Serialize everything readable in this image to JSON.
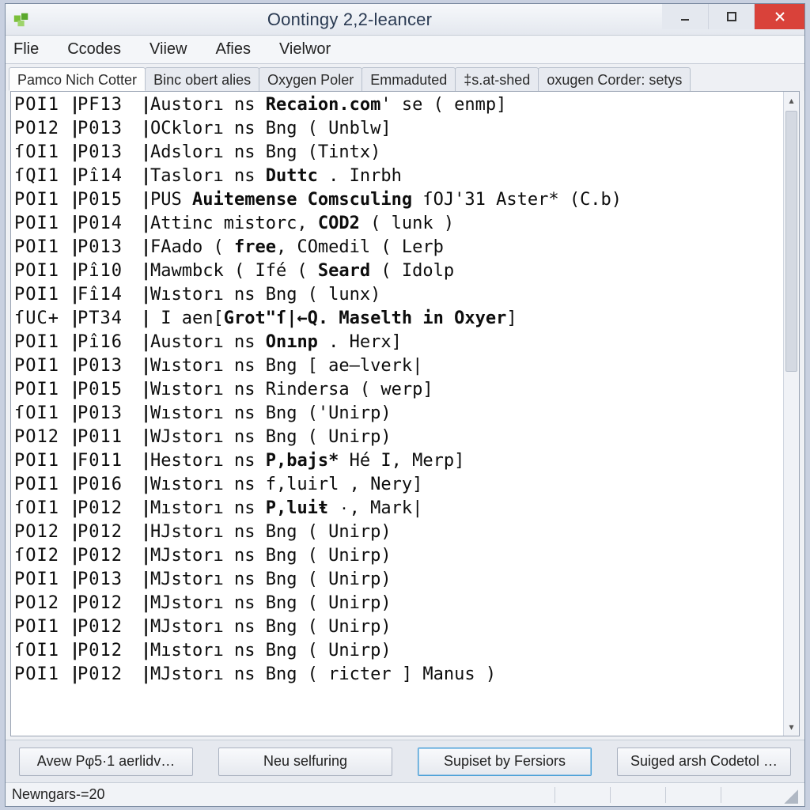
{
  "window": {
    "title": "Oontingy 2,2-leancer"
  },
  "menubar": {
    "items": [
      "Flie",
      "Ccodes",
      "Viiew",
      "Afies",
      "Vielwor"
    ]
  },
  "tabs": [
    {
      "label": "Pamco Nich Cotter",
      "active": true
    },
    {
      "label": "Binc obert alies",
      "active": false
    },
    {
      "label": "Oxygen Poler",
      "active": false
    },
    {
      "label": "Emmaduted",
      "active": false
    },
    {
      "label": "‡s.at-shed",
      "active": false
    },
    {
      "label": "oxugen Corder: setys",
      "active": false
    }
  ],
  "rows": [
    {
      "a": "POI1",
      "b": "PF13",
      "c_pre": "Austorı ns ",
      "c_bold": "Recaion.com",
      "c_post": "' se ( enmp]"
    },
    {
      "a": "PO12",
      "b": "P013",
      "c_pre": "OCklorı ns ",
      "c_bold": "",
      "c_post": "Bng ( Unblw]"
    },
    {
      "a": "ſOI1",
      "b": "P013",
      "c_pre": "Adslorı ns ",
      "c_bold": "",
      "c_post": "Bng (Tintx)"
    },
    {
      "a": "ſQI1",
      "b": "Pî14",
      "c_pre": "Taslorı ns ",
      "c_bold": "Duttc",
      "c_post": " . Inrbh"
    },
    {
      "a": "POI1",
      "b": "P015",
      "c_pre": "PUS ",
      "c_bold": "Auitemense Comsculing",
      "c_post": " ſOJ'31 Aster* (C.b)"
    },
    {
      "a": "POI1",
      "b": "P014",
      "c_pre": "Attinc mistorc, ",
      "c_bold": "COD2",
      "c_post": " ( lunk )"
    },
    {
      "a": "POI1",
      "b": "P013",
      "c_pre": "FAado ( ",
      "c_bold": "free",
      "c_post": ", COmedil ( Lerþ"
    },
    {
      "a": "POI1",
      "b": "Pî10",
      "c_pre": "Mawmbck ( Ifé ( ",
      "c_bold": "Seard",
      "c_post": " ( Idolp"
    },
    {
      "a": "POI1",
      "b": "Fî14",
      "c_pre": "W",
      "c_bold": "",
      "c_post": "ıstorı ns Bng ( lunx)"
    },
    {
      "a": "ſUC+",
      "b": "PT34",
      "c_pre": " I aen[",
      "c_bold": "Grot\"ſ|←Q. Maselth in Oxyer",
      "c_post": "]"
    },
    {
      "a": "POI1",
      "b": "Pî16",
      "c_pre": "Austorı ns ",
      "c_bold": "Onınp",
      "c_post": " . Herx]"
    },
    {
      "a": "POI1",
      "b": "P013",
      "c_pre": "W",
      "c_bold": "",
      "c_post": "ıstorı ns Bng [ ae–lverk|"
    },
    {
      "a": "POI1",
      "b": "P015",
      "c_pre": "W",
      "c_bold": "",
      "c_post": "ıstorı ns Rindersa ( werp]"
    },
    {
      "a": "ſOI1",
      "b": "P013",
      "c_pre": "W",
      "c_bold": "",
      "c_post": "ıstorı ns Bng ('Unirp)"
    },
    {
      "a": "PO12",
      "b": "P011",
      "c_pre": "W",
      "c_bold": "",
      "c_post": "Jstorı ns Bng ( Unirp)"
    },
    {
      "a": "POI1",
      "b": "F011",
      "c_pre": "Hestorı ns ",
      "c_bold": "P,bajs*",
      "c_post": " Hé I, Merp]"
    },
    {
      "a": "POI1",
      "b": "P016",
      "c_pre": "W",
      "c_bold": "",
      "c_post": "ıstorı ns f,luirl , Nery]"
    },
    {
      "a": "ſOI1",
      "b": "P012",
      "c_pre": "Mıstorı ns ",
      "c_bold": "P,luiŧ",
      "c_post": " ۰, Mark|"
    },
    {
      "a": "PO12",
      "b": "P012",
      "c_pre": "H",
      "c_bold": "",
      "c_post": "Jstorı ns Bng ( Unirp)"
    },
    {
      "a": "ſOI2",
      "b": "P012",
      "c_pre": "M",
      "c_bold": "",
      "c_post": "Jstorı ns Bng ( Unirp)"
    },
    {
      "a": "POI1",
      "b": "P013",
      "c_pre": "M",
      "c_bold": "",
      "c_post": "Jstorı ns Bng ( Unirp)"
    },
    {
      "a": "PO12",
      "b": "P012",
      "c_pre": "M",
      "c_bold": "",
      "c_post": "Jstorı ns Bng ( Unirp)"
    },
    {
      "a": "POI1",
      "b": "P012",
      "c_pre": "M",
      "c_bold": "",
      "c_post": "Jstorı ns Bng ( Unirp)"
    },
    {
      "a": "ſOI1",
      "b": "P012",
      "c_pre": "M",
      "c_bold": "",
      "c_post": "ıstorı ns Bng ( Unirp)"
    },
    {
      "a": "POI1",
      "b": "P012",
      "c_pre": "M",
      "c_bold": "",
      "c_post": "Jstorı ns Bng ( ricter ] Manus )"
    }
  ],
  "buttons": {
    "b1": "Avew Pφ5·1 aerlidv…",
    "b2": "Neu selfuring",
    "b3": "Supiset by Fersiors",
    "b4": "Suiged arsh Codetol …"
  },
  "status": {
    "text": "Newngars-=20"
  }
}
